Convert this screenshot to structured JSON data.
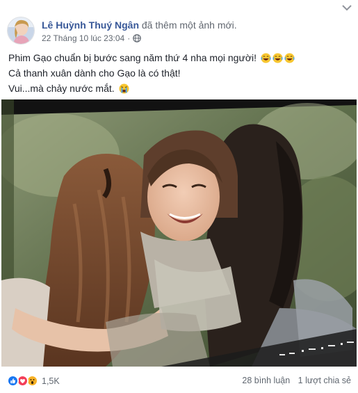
{
  "post": {
    "author": "Lê Huỳnh Thuý Ngân",
    "action": "đã thêm một ảnh mới.",
    "timestamp": "22 Tháng 10 lúc 23:04",
    "separator": "·",
    "privacy_icon": "globe-icon",
    "caption": {
      "line1": "Phim Gạo chuẩn bị bước sang năm thứ 4 nha mọi người!",
      "line1_emojis": [
        "grinning-tears-emoji",
        "grinning-tears-emoji",
        "grinning-tears-emoji"
      ],
      "line2": "Cả thanh xuân dành cho Gạo là có thật!",
      "line3": "Vui...mà chảy nước mắt.",
      "line3_emoji": "crying-emoji"
    },
    "photo": {
      "description_icon": "photo"
    }
  },
  "footer": {
    "reactions": [
      "like-icon",
      "love-icon",
      "wow-icon"
    ],
    "reaction_count": "1,5K",
    "comments": "28 bình luận",
    "shares": "1 lượt chia sẻ"
  },
  "colors": {
    "link": "#385898",
    "meta": "#606770",
    "like": "#1877f2",
    "love": "#f33e58",
    "wow": "#f7b125"
  }
}
